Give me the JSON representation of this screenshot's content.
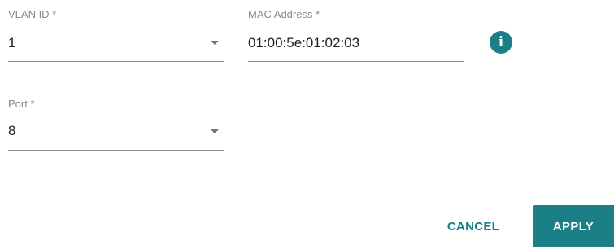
{
  "form": {
    "vlan_id": {
      "label": "VLAN ID *",
      "value": "1",
      "icon": "chevron-down-icon"
    },
    "mac_address": {
      "label": "MAC Address *",
      "value": "01:00:5e:01:02:03"
    },
    "info": {
      "icon": "info-icon",
      "glyph": "i"
    },
    "port": {
      "label": "Port *",
      "value": "8",
      "icon": "chevron-down-icon"
    }
  },
  "actions": {
    "cancel_label": "CANCEL",
    "apply_label": "APPLY"
  },
  "colors": {
    "accent": "#1a7f86",
    "label": "#8a8a8a",
    "text": "#212121",
    "underline": "#8f8f8f"
  }
}
